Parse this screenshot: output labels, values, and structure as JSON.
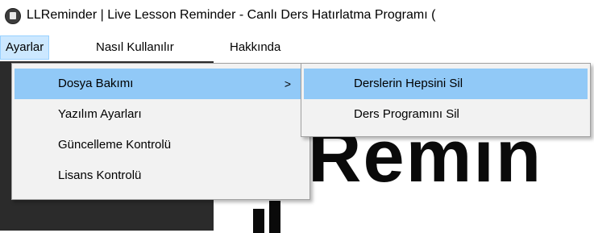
{
  "window": {
    "title": "LLReminder | Live Lesson Reminder - Canlı Ders Hatırlatma Programı (",
    "icon": "app-icon"
  },
  "menubar": {
    "items": [
      {
        "label": "Ayarlar"
      },
      {
        "label": "Nasıl Kullanılır"
      },
      {
        "label": "Hakkında"
      }
    ]
  },
  "ayarlar_menu": {
    "items": [
      {
        "label": "Dosya Bakımı",
        "submenu_arrow": ">"
      },
      {
        "label": "Yazılım Ayarları"
      },
      {
        "label": "Güncelleme Kontrolü"
      },
      {
        "label": "Lisans Kontrolü"
      }
    ]
  },
  "dosya_bakimi_submenu": {
    "items": [
      {
        "label": "Derslerin Hepsini Sil"
      },
      {
        "label": "Ders Programını Sil"
      }
    ]
  },
  "background": {
    "logo_text": "Remin"
  },
  "colors": {
    "menu_highlight": "#91c9f7",
    "menu_active": "#cce8ff",
    "menu_bg": "#f2f2f2",
    "dark_panel": "#2b2b2b"
  }
}
